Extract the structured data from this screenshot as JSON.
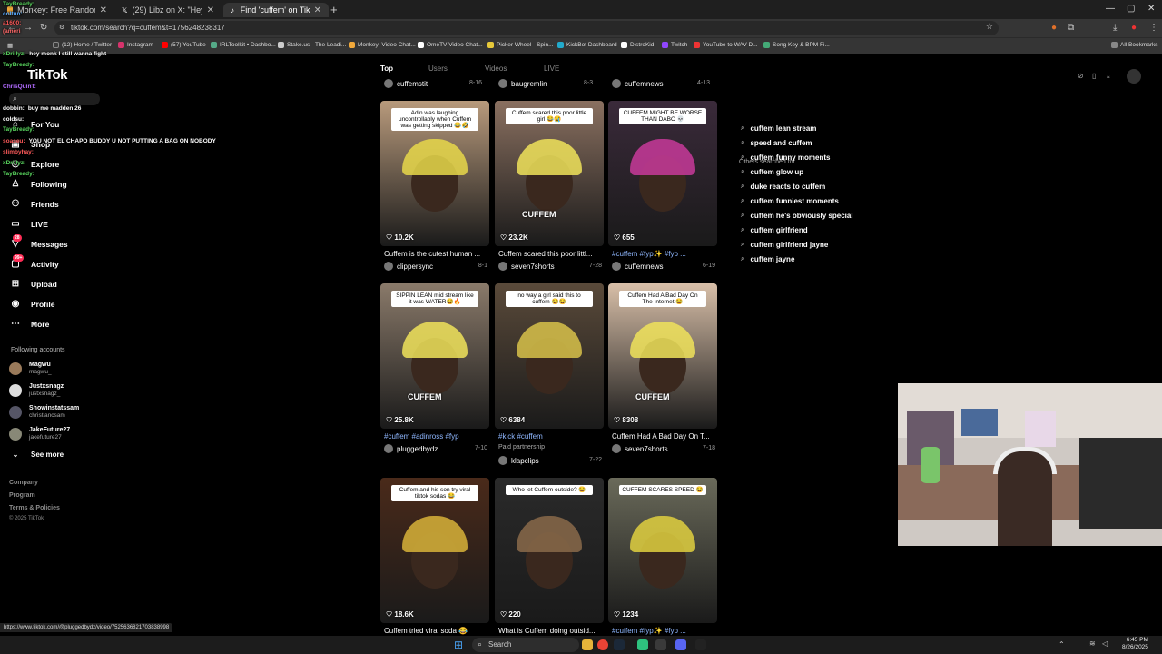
{
  "browser": {
    "tabs": [
      {
        "label": "Monkey: Free Random Video C",
        "active": false,
        "favicon_color": "#f2a93b"
      },
      {
        "label": "(29) Libz on X: \"Heyy cuffem i\"",
        "active": false,
        "favicon_color": "#ffffff"
      },
      {
        "label": "Find 'cuffem' on TikTok | TikTo",
        "active": true,
        "favicon_color": "#ffffff"
      }
    ],
    "url": "tiktok.com/search?q=cuffem&t=1756248238317",
    "bookmarks": [
      "(12) Home / Twitter",
      "Instagram",
      "(57) YouTube",
      "IRLToolkit • Dashbo...",
      "Stake.us - The Leadi...",
      "Monkey: Video Chat...",
      "OmeTV Video Chat...",
      "Picker Wheel - Spin...",
      "KickBot Dashboard",
      "DistroKid",
      "Twitch",
      "YouTube to WAV D...",
      "Song Key & BPM Fi..."
    ],
    "all_bookmarks": "All Bookmarks",
    "status_url": "https://www.tiktok.com/@pluggedbydz/video/7525636821703838998"
  },
  "sidebar": {
    "logo": "TikTok",
    "nav": [
      {
        "label": "For You",
        "icon": "home-icon"
      },
      {
        "label": "Shop",
        "icon": "shop-icon"
      },
      {
        "label": "Explore",
        "icon": "compass-icon"
      },
      {
        "label": "Following",
        "icon": "following-icon"
      },
      {
        "label": "Friends",
        "icon": "friends-icon"
      },
      {
        "label": "LIVE",
        "icon": "live-icon"
      },
      {
        "label": "Messages",
        "icon": "messages-icon",
        "badge": "28"
      },
      {
        "label": "Activity",
        "icon": "activity-icon",
        "badge": "99+"
      },
      {
        "label": "Upload",
        "icon": "upload-icon"
      },
      {
        "label": "Profile",
        "icon": "profile-icon"
      },
      {
        "label": "More",
        "icon": "more-icon"
      }
    ],
    "following_header": "Following accounts",
    "accounts": [
      {
        "name": "Magwu",
        "handle": "magwu_"
      },
      {
        "name": "Justxsnagz",
        "handle": "justxsnagz_"
      },
      {
        "name": "Showinstatssam",
        "handle": "christiancsam"
      },
      {
        "name": "JakeFuture27",
        "handle": "jakefuture27"
      }
    ],
    "see_more": "See more",
    "footer": [
      "Company",
      "Program",
      "Terms & Policies",
      "© 2025 TikTok"
    ]
  },
  "chat": [
    {
      "user": "TayBready:",
      "msg": "",
      "color": "#59d65e"
    },
    {
      "user": "coltun:",
      "msg": "",
      "color": "#57a9ff"
    },
    {
      "user": "a1600:",
      "msg": "",
      "color": "#ff5a5a"
    },
    {
      "user": "(ameri",
      "msg": "",
      "color": "#ff6a6a"
    },
    {
      "user": "xDrillyz:",
      "msg": "hey monk I still wanna fight",
      "color": "#59d65e"
    },
    {
      "user": "TayBready:",
      "msg": "",
      "color": "#59d65e"
    },
    {
      "user": "ChrisQuinT:",
      "msg": "",
      "color": "#b16bff"
    },
    {
      "user": "dobbin:",
      "msg": "buy me madden 26",
      "color": "#ffffff"
    },
    {
      "user": "coldsu:",
      "msg": "",
      "color": "#ffffff"
    },
    {
      "user": "TayBready:",
      "msg": "",
      "color": "#59d65e"
    },
    {
      "user": "soaseu:",
      "msg": "YOU NOT EL CHAPO BUDDY U NOT PUTTING A BAG ON NOBODY",
      "color": "#ff5a5a"
    },
    {
      "user": "slimbyhay:",
      "msg": "",
      "color": "#ff5a5a"
    },
    {
      "user": "xDrillyz:",
      "msg": "",
      "color": "#59d65e"
    },
    {
      "user": "TayBready:",
      "msg": "",
      "color": "#59d65e"
    }
  ],
  "search_tabs": [
    "Top",
    "Users",
    "Videos",
    "LIVE"
  ],
  "videos": [
    {
      "author": "cuffemstit",
      "date": "8-16"
    },
    {
      "author": "baugremlin",
      "date": "8-3"
    },
    {
      "author": "cuffemnews",
      "date": "4-13"
    },
    {
      "views": "10.2K",
      "title": "Cuffem is the cutest human ...",
      "author": "clippersync",
      "date": "8-1",
      "caption": "Adin was laughing uncontrollably when Cuffem was getting skipped 😂🤣",
      "bg": "#b89a7c",
      "accent": "#e8d84a"
    },
    {
      "views": "23.2K",
      "title": "Cuffem scared this poor littl...",
      "author": "seven7shorts",
      "date": "7-28",
      "caption": "Cuffem scared this poor little girl 😂😭",
      "brand": "CUFFEM",
      "bg": "#8a7060",
      "accent": "#f0e35a"
    },
    {
      "views": "655",
      "title": "#cuffem #fyp✨ #fyp ...",
      "author": "cuffemnews",
      "date": "6-19",
      "caption": "CUFFEM MIGHT BE WORSE THAN DABO 💀",
      "bg": "#3a2a3a",
      "accent": "#c83a9a"
    },
    {
      "views": "25.8K",
      "title": "#cuffem #adinross #fyp",
      "author": "pluggedbydz",
      "date": "7-10",
      "caption": "SIPPIN LEAN mid stream like it was WATER😂🔥",
      "brand": "CUFFEM",
      "bg": "#8a7a6a",
      "accent": "#f0e35a"
    },
    {
      "views": "6384",
      "title": "#kick #cuffem",
      "author": "klapclips",
      "date": "7-22",
      "partner": "Paid partnership",
      "caption": "no way a girl said this to cuffem 😂😂",
      "bg": "#5a4a3a",
      "accent": "#d8c24a"
    },
    {
      "views": "8308",
      "title": "Cuffem Had A Bad Day On T...",
      "author": "seven7shorts",
      "date": "7-18",
      "caption": "Cuffem Had A Bad Day On The Internet 😂",
      "brand": "CUFFEM",
      "bg": "#d8bfa8",
      "accent": "#f0e35a"
    },
    {
      "views": "18.6K",
      "title": "Cuffem tried viral soda 😂",
      "caption": "Cuffem and his son try viral tiktok sodas 😂",
      "bg": "#4a2a1a",
      "accent": "#d8b33a"
    },
    {
      "views": "220",
      "title": "What is Cuffem doing outsid...",
      "caption": "Who let Cuffem outside? 😂",
      "bg": "#2a2a2a",
      "accent": "#8a6a4a"
    },
    {
      "views": "1234",
      "title": "#cuffem #fyp✨ #fyp ...",
      "caption": "CUFFEM SCARES SPEED 😂",
      "bg": "#6a6a5a",
      "accent": "#e0d040"
    }
  ],
  "others_searched": {
    "header": "Others searched for",
    "items": [
      "cuffem lean stream",
      "speed and cuffem",
      "cuffem funny moments",
      "cuffem glow up",
      "duke reacts to cuffem",
      "cuffem funniest moments",
      "cuffem he's obviously special",
      "cuffem girlfriend",
      "cuffem girlfriend jayne",
      "cuffem jayne"
    ]
  },
  "taskbar": {
    "search": "Search",
    "time": "6:45 PM",
    "date": "8/26/2025"
  }
}
